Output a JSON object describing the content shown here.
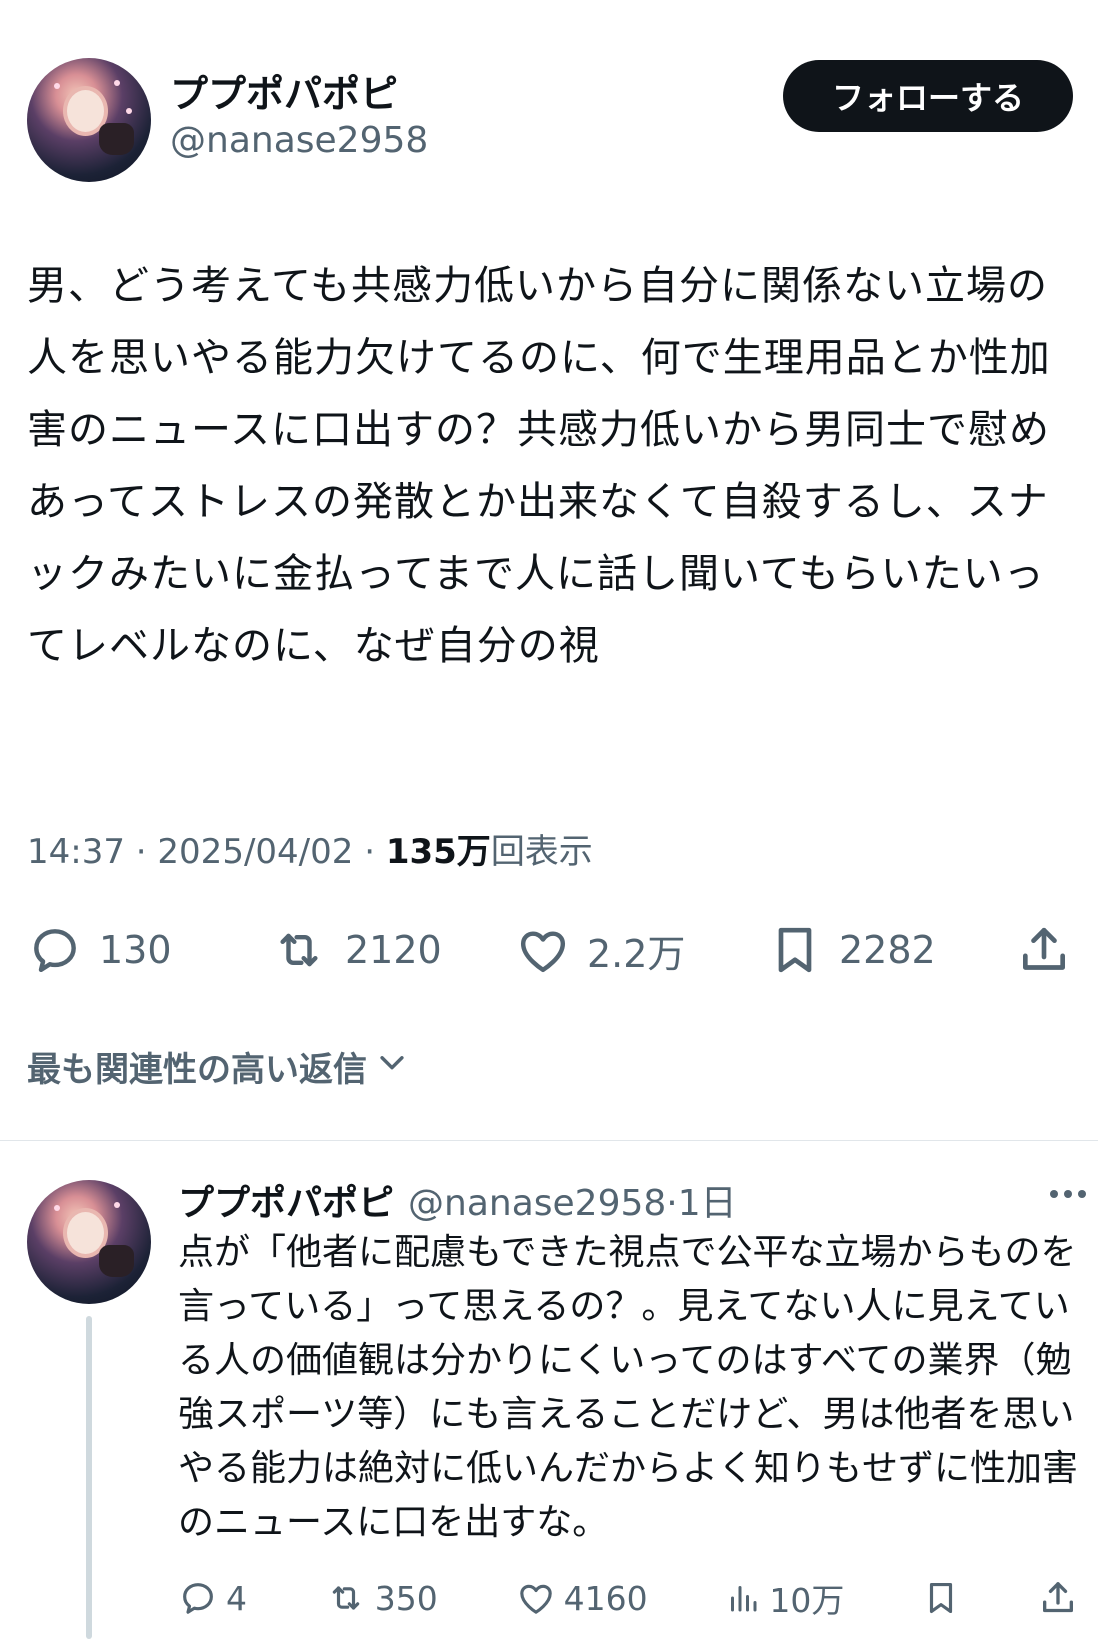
{
  "post": {
    "author": {
      "display_name": "ププポパポピ",
      "handle": "@nanase2958"
    },
    "follow_label": "フォローする",
    "text": "男、どう考えても共感力低いから自分に関係ない立場の人を思いやる能力欠けてるのに、何で生理用品とか性加害のニュースに口出すの？共感力低いから男同士で慰めあってストレスの発散とか出来なくて自殺するし、スナックみたいに金払ってまで人に話し聞いてもらいたいってレベルなのに、なぜ自分の視",
    "time": "14:37",
    "separator": "·",
    "date": "2025/04/02",
    "views_count": "135万",
    "views_label": "回表示",
    "stats": {
      "replies": "130",
      "reposts": "2120",
      "likes": "2.2万",
      "bookmarks": "2282"
    }
  },
  "replies_sort_label": "最も関連性の高い返信",
  "reply": {
    "display_name": "ププポパポピ",
    "handle": "@nanase2958",
    "separator": "·",
    "time": "1日",
    "text": "点が「他者に配慮もできた視点で公平な立場からものを言っている」って思えるの？。見えてない人に見えている人の価値観は分かりにくいってのはすべての業界（勉強スポーツ等）にも言えることだけど、男は他者を思いやる能力は絶対に低いんだからよく知りもせずに性加害のニュースに口を出すな。",
    "stats": {
      "replies": "4",
      "reposts": "350",
      "likes": "4160",
      "views": "10万"
    }
  },
  "colors": {
    "text": "#0f1419",
    "secondary": "#536471",
    "button_bg": "#0f1419",
    "thread_line": "#cfd9de"
  },
  "icons": [
    "reply-icon",
    "repost-icon",
    "like-icon",
    "bookmark-icon",
    "share-icon",
    "views-icon",
    "more-icon",
    "chevron-down-icon"
  ]
}
